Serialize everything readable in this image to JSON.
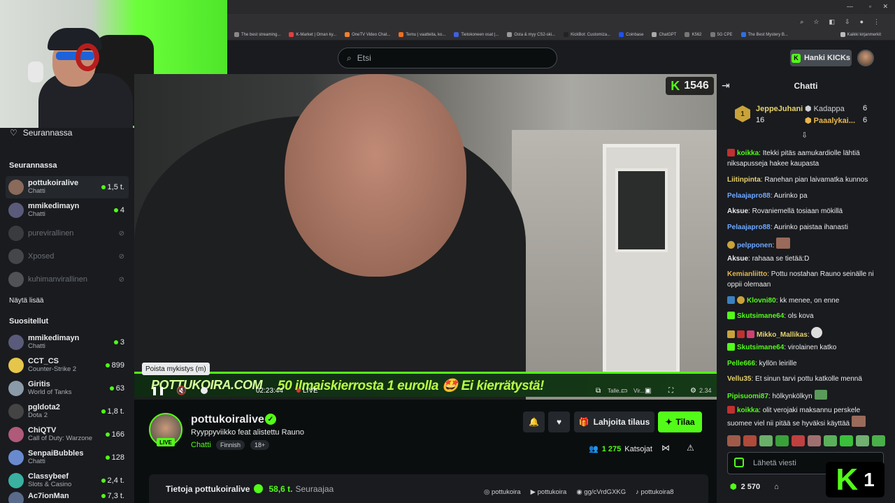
{
  "browser": {
    "bookmarks": [
      "The best streaming...",
      "K-Market | Oman ky...",
      "OneTV Video Chat...",
      "Temu | vaatteita, ko...",
      "Tietokoneen osat |...",
      "Osta & myy CS2-ski...",
      "KickBot: Customiza...",
      "Coinbase",
      "ChatGPT",
      "K562",
      "5G CPE",
      "The Best Mystery B..."
    ],
    "all_bookmarks": "Kaikki kirjanmerkit"
  },
  "header": {
    "search_placeholder": "Etsi",
    "kicks_label": "Hanki KICKs"
  },
  "sidebar": {
    "following_label": "Seurannassa",
    "following_heading": "Seurannassa",
    "following": [
      {
        "name": "pottukoiralive",
        "category": "Chatti",
        "count": "1,5 t.",
        "live": true,
        "avatar": "#8a6a5a"
      },
      {
        "name": "mmikedimayn",
        "category": "Chatti",
        "count": "4",
        "live": true,
        "avatar": "#5a5a7a"
      },
      {
        "name": "purevirallinen",
        "category": "",
        "count": "",
        "live": false,
        "avatar": "#777"
      },
      {
        "name": "Xposed",
        "category": "",
        "count": "",
        "live": false,
        "avatar": "#999"
      },
      {
        "name": "kuhimanvirallinen",
        "category": "",
        "count": "",
        "live": false,
        "avatar": "#bbb"
      }
    ],
    "show_more": "Näytä lisää",
    "recommended_heading": "Suositellut",
    "recommended": [
      {
        "name": "mmikedimayn",
        "category": "Chatti",
        "count": "3",
        "avatar": "#5a5a7a"
      },
      {
        "name": "CCT_CS",
        "category": "Counter-Strike 2",
        "count": "899",
        "avatar": "#e6c64a"
      },
      {
        "name": "Giritis",
        "category": "World of Tanks",
        "count": "63",
        "avatar": "#8b9aa8"
      },
      {
        "name": "pgldota2",
        "category": "Dota 2",
        "count": "1,8 t.",
        "avatar": "#444"
      },
      {
        "name": "ChiQTV",
        "category": "Call of Duty: Warzone",
        "count": "166",
        "avatar": "#b05a7a"
      },
      {
        "name": "SenpaiBubbles",
        "category": "Chatti",
        "count": "128",
        "avatar": "#6a8ad0"
      },
      {
        "name": "Classybeef",
        "category": "Slots & Casino",
        "count": "2,4 t.",
        "avatar": "#3ab0a0"
      },
      {
        "name": "Ac7ionMan",
        "category": "",
        "count": "7,3 t.",
        "avatar": "#5a6a8a"
      }
    ]
  },
  "video": {
    "viewer_count": "1546",
    "banner_brand": "POTTUKOIRA.COM",
    "banner_promo": "50 ilmaiskierrosta 1 eurolla 🤩 Ei kierrätystä!",
    "time": "02:23:44",
    "live_label": "LIVE",
    "tooltip": "Poista mykistys (m)",
    "ctl_tallenna": "Talle...",
    "ctl_vir": "Vir...",
    "ctl_quality": "2.34"
  },
  "channel": {
    "name": "pottukoiralive",
    "live_tag": "LIVE",
    "title": "Ryyppyviikko feat alistettu Rauno",
    "category": "Chatti",
    "tags": [
      "Finnish",
      "18+"
    ],
    "gift_label": "Lahjoita tilaus",
    "subscribe_label": "Tilaa",
    "viewers": "1 275",
    "viewers_label": "Katsojat",
    "about_title": "Tietoja pottukoiralive",
    "followers": "58,6 t.",
    "followers_label": "Seuraajaa",
    "socials": [
      "pottukoira",
      "pottukoira",
      "gg/cVrdGXKG",
      "pottukoira8"
    ]
  },
  "chat": {
    "title": "Chatti",
    "leaderboard": [
      {
        "rank": "1",
        "name": "JeppeJuhani",
        "count": "16"
      },
      {
        "name": "Kadappa",
        "count": "6"
      },
      {
        "name": "Paaalykai...",
        "count": "6"
      }
    ],
    "messages": [
      {
        "user": "koikka",
        "color": "#53fc18",
        "text": "Itekki pitäs aamukardiolle lähtiä niksapusseja hakee kaupasta"
      },
      {
        "user": "Liitinpinta",
        "color": "#e8d26a",
        "text": "Ranehan pian laivamatka kunnos"
      },
      {
        "user": "Pelaajapro88",
        "color": "#6fa8ff",
        "text": "Aurinko pa"
      },
      {
        "user": "Aksue",
        "color": "#e9eaeb",
        "text": "Rovaniemellä tosiaan mökillä"
      },
      {
        "user": "Pelaajapro88",
        "color": "#6fa8ff",
        "text": "Aurinko paistaa ihanasti"
      },
      {
        "user": "pelpponen",
        "color": "#6fa8ff",
        "text": ""
      },
      {
        "user": "Aksue",
        "color": "#e9eaeb",
        "text": "rahaaa se tietää:D"
      },
      {
        "user": "Kemianliitto",
        "color": "#e8b64a",
        "text": "Pottu nostahan Rauno seinälle ni oppii olemaan"
      },
      {
        "user": "Klovni80",
        "color": "#53fc18",
        "text": "kk menee, on enne"
      },
      {
        "user": "Skutsimane64",
        "color": "#53fc18",
        "text": "ols kova"
      },
      {
        "user": "Mikko_Mallikas",
        "color": "#e8d26a",
        "text": ""
      },
      {
        "user": "Skutsimane64",
        "color": "#53fc18",
        "text": "virolainen katko"
      },
      {
        "user": "Pelle666",
        "color": "#53fc18",
        "text": "kyllön leirille"
      },
      {
        "user": "Vellu35",
        "color": "#e8d26a",
        "text": "Et sinun tarvi pottu katkolle mennä"
      },
      {
        "user": "Pipisuomi87",
        "color": "#53fc18",
        "text": "hölkynkölkyn"
      },
      {
        "user": "koikka",
        "color": "#53fc18",
        "text": "olit verojaki maksannu perskele suomee viel nii pitää se hyväksi käyttää"
      }
    ],
    "input_placeholder": "Lähetä viesti",
    "points": "2 570",
    "kick_logo_number": "1"
  }
}
